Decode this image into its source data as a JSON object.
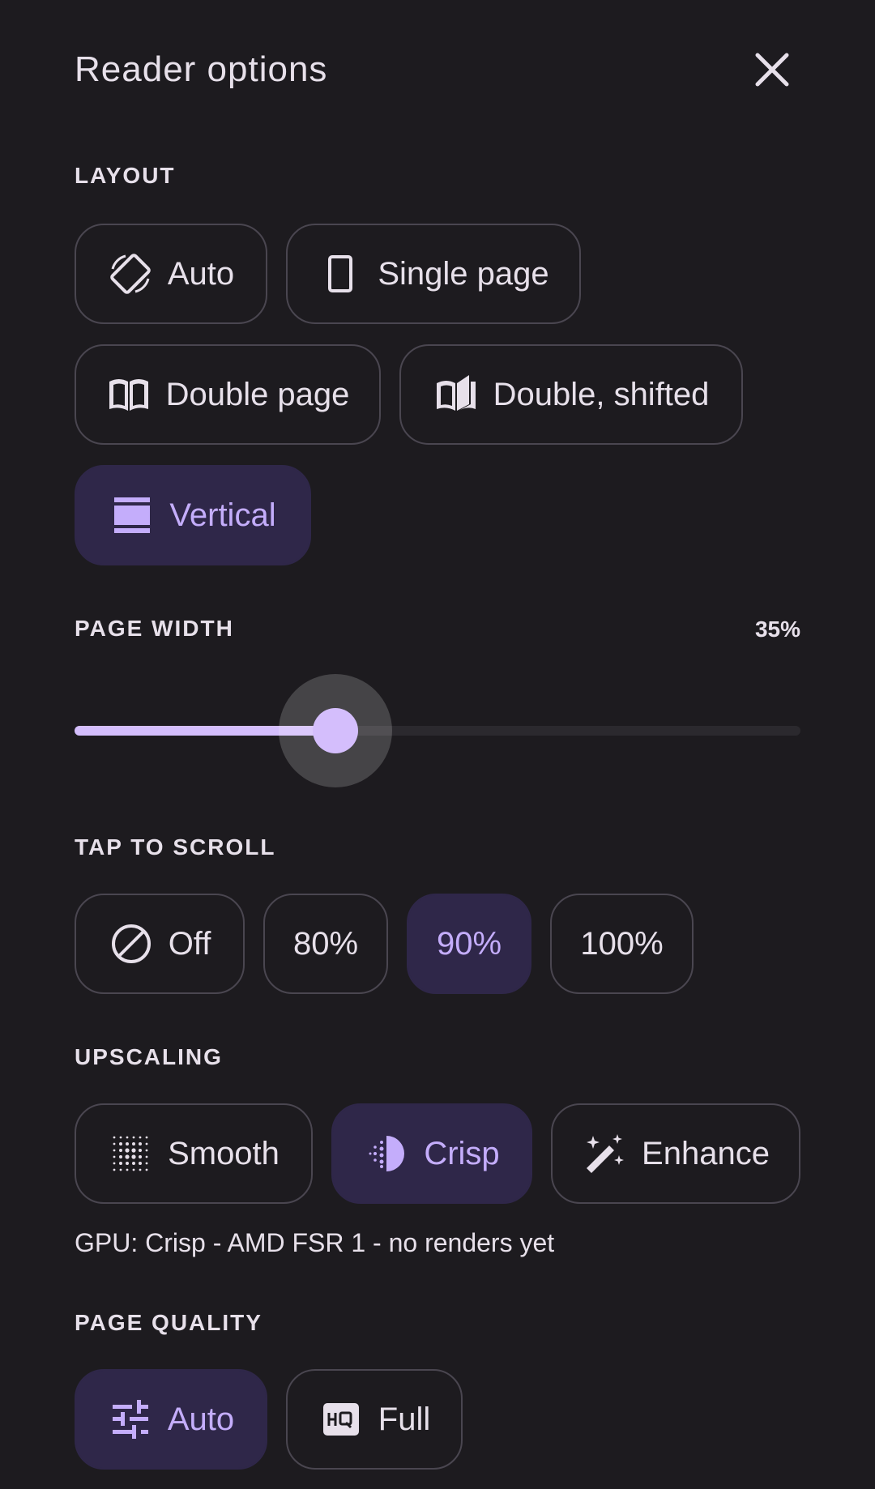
{
  "header": {
    "title": "Reader options"
  },
  "layout": {
    "label": "LAYOUT",
    "options": [
      {
        "label": "Auto",
        "icon": "screen-rotation-icon",
        "selected": false
      },
      {
        "label": "Single page",
        "icon": "single-page-icon",
        "selected": false
      },
      {
        "label": "Double page",
        "icon": "open-book-icon",
        "selected": false
      },
      {
        "label": "Double, shifted",
        "icon": "shifted-book-icon",
        "selected": false
      },
      {
        "label": "Vertical",
        "icon": "vertical-stack-icon",
        "selected": true
      }
    ]
  },
  "page_width": {
    "label": "PAGE WIDTH",
    "value_text": "35%",
    "value": 0.35
  },
  "tap_to_scroll": {
    "label": "TAP TO SCROLL",
    "options": [
      {
        "label": "Off",
        "icon": "block-icon",
        "selected": false
      },
      {
        "label": "80%",
        "selected": false
      },
      {
        "label": "90%",
        "selected": true
      },
      {
        "label": "100%",
        "selected": false
      }
    ]
  },
  "upscaling": {
    "label": "UPSCALING",
    "options": [
      {
        "label": "Smooth",
        "icon": "blur-dots-icon",
        "selected": false
      },
      {
        "label": "Crisp",
        "icon": "contrast-half-icon",
        "selected": true
      },
      {
        "label": "Enhance",
        "icon": "magic-wand-icon",
        "selected": false
      }
    ],
    "gpu_info": "GPU: Crisp - AMD FSR 1 - no renders yet"
  },
  "page_quality": {
    "label": "PAGE QUALITY",
    "options": [
      {
        "label": "Auto",
        "icon": "tune-sliders-icon",
        "selected": true
      },
      {
        "label": "Full",
        "icon": "hq-icon",
        "selected": false
      }
    ]
  },
  "colors": {
    "background": "#1d1b1f",
    "accent": "#c4adfb",
    "selected_bg": "#2f2749",
    "outline": "#4a4650"
  }
}
